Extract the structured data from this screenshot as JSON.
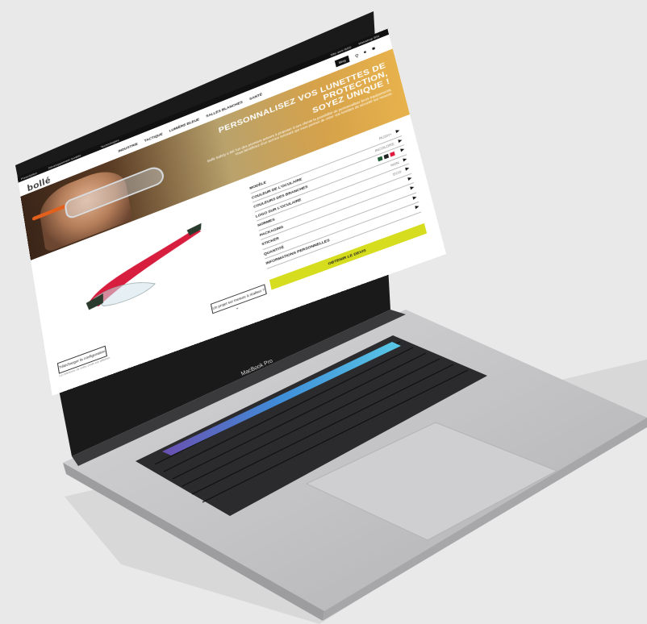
{
  "topbar": {
    "links": [
      "Prescription",
      "Développement durable",
      "Technologies"
    ],
    "right": [
      "Site web BSS",
      "Webshop BSI"
    ]
  },
  "brand": {
    "logo": "bollé",
    "tagline": "SAFETY"
  },
  "nav": {
    "items": [
      "INDUSTRIE",
      "TACTIQUE",
      "LUMIÈRE BLEUE",
      "SALLES BLANCHES",
      "SANTÉ"
    ],
    "blog": "Blog"
  },
  "hero": {
    "title_lines": [
      "PERSONNALISEZ VOS LUNETTES DE",
      "PROTECTION,",
      "SOYEZ UNIQUE !"
    ],
    "subtitle": "Bollé Safety a été l’un des premiers acteurs à proposer à ses clients la possibilité de personnaliser leurs équipements. Vous bénéficiez d’un service innovant qui vous permet de créer vos lunettes de sécurité sur mesure."
  },
  "configurator": {
    "options": [
      {
        "label": "MODÈLE",
        "value": "RUSH+"
      },
      {
        "label": "COULEUR DE L’OCULAIRE",
        "value": "INCOLORE"
      },
      {
        "label": "COULEURS DES BRANCHES",
        "value": ""
      },
      {
        "label": "LOGO SUR L’OCULAIRE",
        "value": "NON"
      },
      {
        "label": "NORMES",
        "value": "ECO"
      },
      {
        "label": "PACKAGING",
        "value": ""
      },
      {
        "label": "STICKER",
        "value": ""
      },
      {
        "label": "QUANTITÉ",
        "value": ""
      },
      {
        "label": "INFORMATIONS PERSONNELLES",
        "value": ""
      }
    ],
    "quote_button": "OBTENIR LE DEVIS",
    "swatch_colors": [
      "#1f5c35",
      "#222222",
      "#e01a3c"
    ]
  },
  "project_button": "Un projet sur mesure à réaliser ?",
  "download": {
    "label": "Télécharger la configuration",
    "note": "La référence de votre choix est affichée."
  },
  "laptop": {
    "model": "MacBook Pro"
  },
  "colors": {
    "accent": "#d6dc1e",
    "brand_red": "#e01a3c"
  }
}
